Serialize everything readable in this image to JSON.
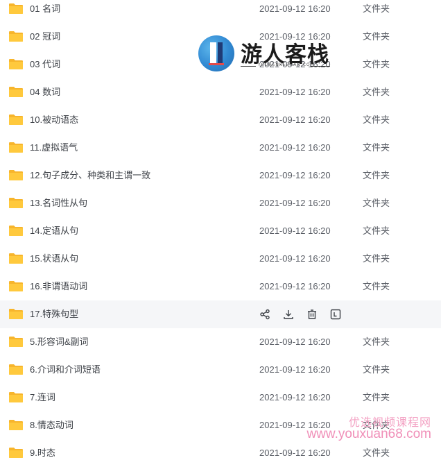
{
  "files": [
    {
      "name": "01 名词",
      "date": "2021-09-12 16:20",
      "type": "文件夹"
    },
    {
      "name": "02 冠词",
      "date": "2021-09-12 16:20",
      "type": "文件夹"
    },
    {
      "name": "03 代词",
      "date": "2021-09-12 16:20",
      "type": "文件夹"
    },
    {
      "name": "04 数词",
      "date": "2021-09-12 16:20",
      "type": "文件夹"
    },
    {
      "name": "10.被动语态",
      "date": "2021-09-12 16:20",
      "type": "文件夹"
    },
    {
      "name": "11.虚拟语气",
      "date": "2021-09-12 16:20",
      "type": "文件夹"
    },
    {
      "name": "12.句子成分、种类和主谓一致",
      "date": "2021-09-12 16:20",
      "type": "文件夹"
    },
    {
      "name": "13.名词性从句",
      "date": "2021-09-12 16:20",
      "type": "文件夹"
    },
    {
      "name": "14.定语从句",
      "date": "2021-09-12 16:20",
      "type": "文件夹"
    },
    {
      "name": "15.状语从句",
      "date": "2021-09-12 16:20",
      "type": "文件夹"
    },
    {
      "name": "16.非谓语动词",
      "date": "2021-09-12 16:20",
      "type": "文件夹"
    },
    {
      "name": "17.特殊句型"
    },
    {
      "name": "5.形容词&副词",
      "date": "2021-09-12 16:20",
      "type": "文件夹"
    },
    {
      "name": "6.介词和介词短语",
      "date": "2021-09-12 16:20",
      "type": "文件夹"
    },
    {
      "name": "7.连词",
      "date": "2021-09-12 16:20",
      "type": "文件夹"
    },
    {
      "name": "8.情态动词",
      "date": "2021-09-12 16:20",
      "type": "文件夹"
    },
    {
      "name": "9.时态",
      "date": "2021-09-12 16:20",
      "type": "文件夹"
    }
  ],
  "hover_actions": [
    "share-icon",
    "download-icon",
    "delete-icon",
    "more-icon"
  ],
  "watermark": {
    "logo_text": "游人客栈",
    "logo_sub": "YOURENKEZHAN.COM",
    "site_cn": "优选视频课程网",
    "site_url": "www.youxuan68.com"
  },
  "colors": {
    "folder": "#ffc93d",
    "hover_bg": "#f5f6f8",
    "text": "#3b3f45",
    "watermark_pink": "#f08fb8"
  }
}
